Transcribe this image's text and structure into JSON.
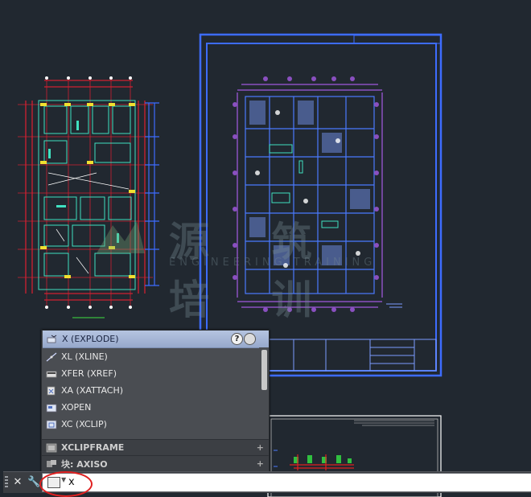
{
  "watermark": {
    "text": "源 筑 培 训",
    "subtitle": "ENGINEERING TRAINING"
  },
  "autocomplete": {
    "items": [
      {
        "label": "X (EXPLODE)",
        "icon": "explode-icon",
        "selected": true
      },
      {
        "label": "XL (XLINE)",
        "icon": "xline-icon"
      },
      {
        "label": "XFER (XREF)",
        "icon": "xref-icon"
      },
      {
        "label": "XA (XATTACH)",
        "icon": "xattach-icon"
      },
      {
        "label": "XOPEN",
        "icon": "xopen-icon"
      },
      {
        "label": "XC (XCLIP)",
        "icon": "xclip-icon"
      }
    ],
    "categories": [
      {
        "label": "XCLIPFRAME",
        "icon": "variable-icon"
      },
      {
        "label": "块: AXISO",
        "icon": "block-icon"
      }
    ],
    "help_label": "?"
  },
  "command_line": {
    "input_value": "x",
    "close_label": "✕",
    "customize_label": "🔧"
  },
  "colors": {
    "background": "#212830",
    "accent": "#3d6cff",
    "annotation": "#e02020"
  }
}
